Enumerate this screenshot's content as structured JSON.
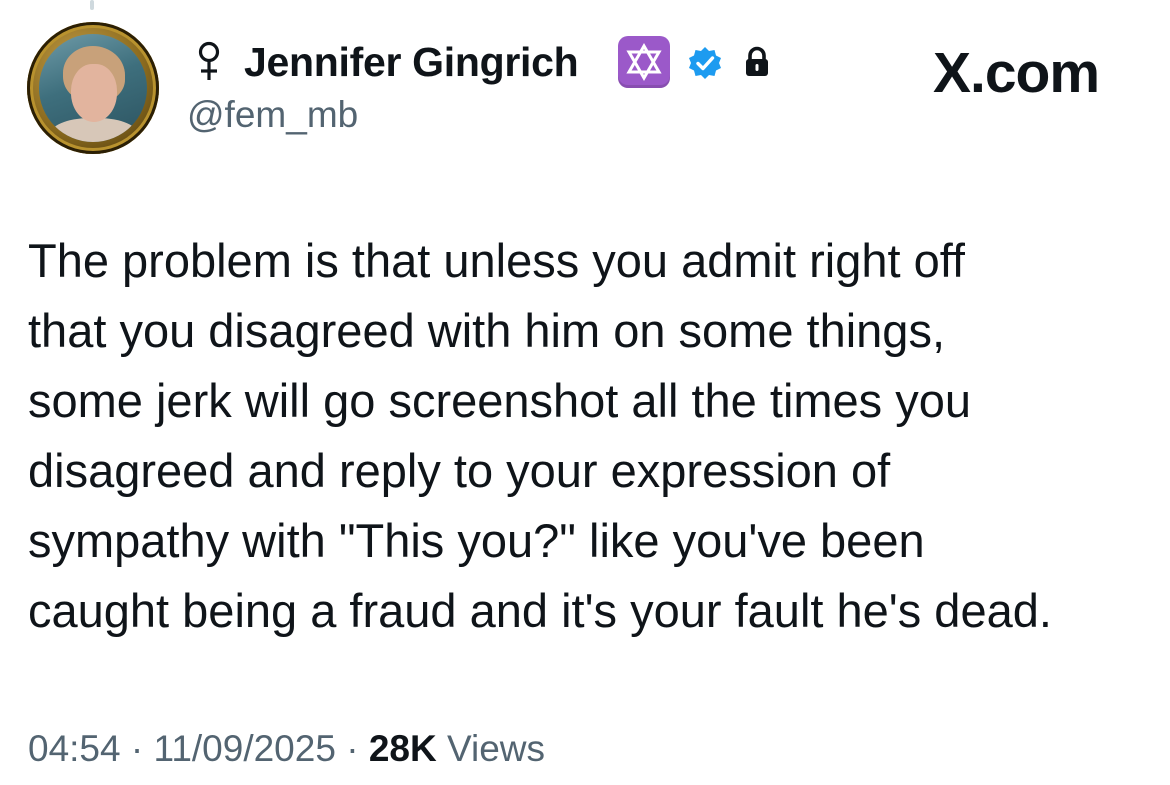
{
  "app": {
    "brand": "X.com"
  },
  "author": {
    "display_name": "Jennifer Gingrich",
    "handle": "@fem_mb",
    "icons": [
      "venus-symbol-icon",
      "star-of-david-icon",
      "verified-badge-icon",
      "lock-icon"
    ]
  },
  "tweet": {
    "lines": [
      "The problem is that unless you admit right off",
      "that you disagreed with him on some things,",
      "some jerk will go screenshot all the times you",
      "disagreed and reply to your expression of",
      "sympathy with \"This you?\" like you've been",
      "caught being a fraud and it's your fault he's dead."
    ]
  },
  "meta": {
    "time": "04:54",
    "separator": " · ",
    "date": "11/09/2025",
    "views_count": "28K",
    "views_label": " Views"
  },
  "colors": {
    "text": "#0f1419",
    "secondary": "#536471",
    "verified": "#1d9bf0",
    "star_badge": "#9b59c9"
  }
}
